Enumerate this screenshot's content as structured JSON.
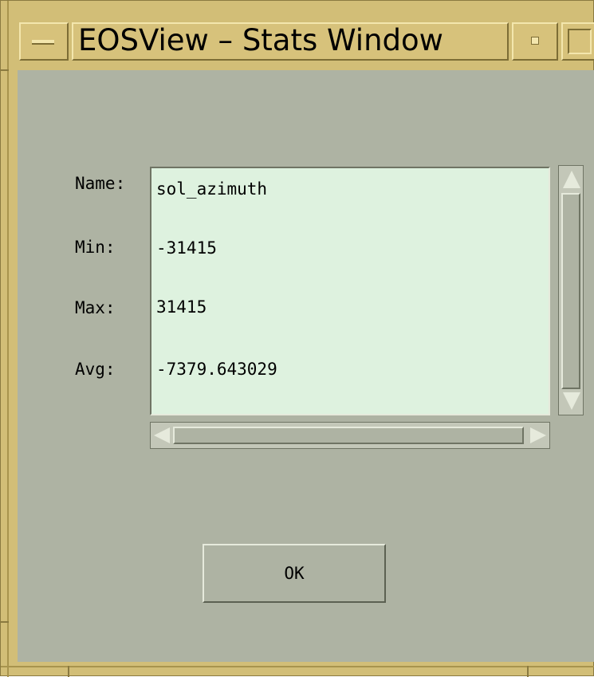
{
  "window": {
    "title": "EOSView – Stats Window",
    "icons": {
      "menu": "window-menu-icon",
      "minimize": "minimize-icon",
      "maximize": "maximize-icon"
    }
  },
  "stats": {
    "labels": {
      "name": "Name:",
      "min": "Min:",
      "max": "Max:",
      "avg": "Avg:"
    },
    "values": {
      "name": "sol_azimuth",
      "min": "-31415",
      "max": "31415",
      "avg": "-7379.643029"
    }
  },
  "buttons": {
    "ok_label": "OK"
  },
  "colors": {
    "frame": "#d2be77",
    "background": "#aeb3a3",
    "text_area": "#def2df"
  }
}
